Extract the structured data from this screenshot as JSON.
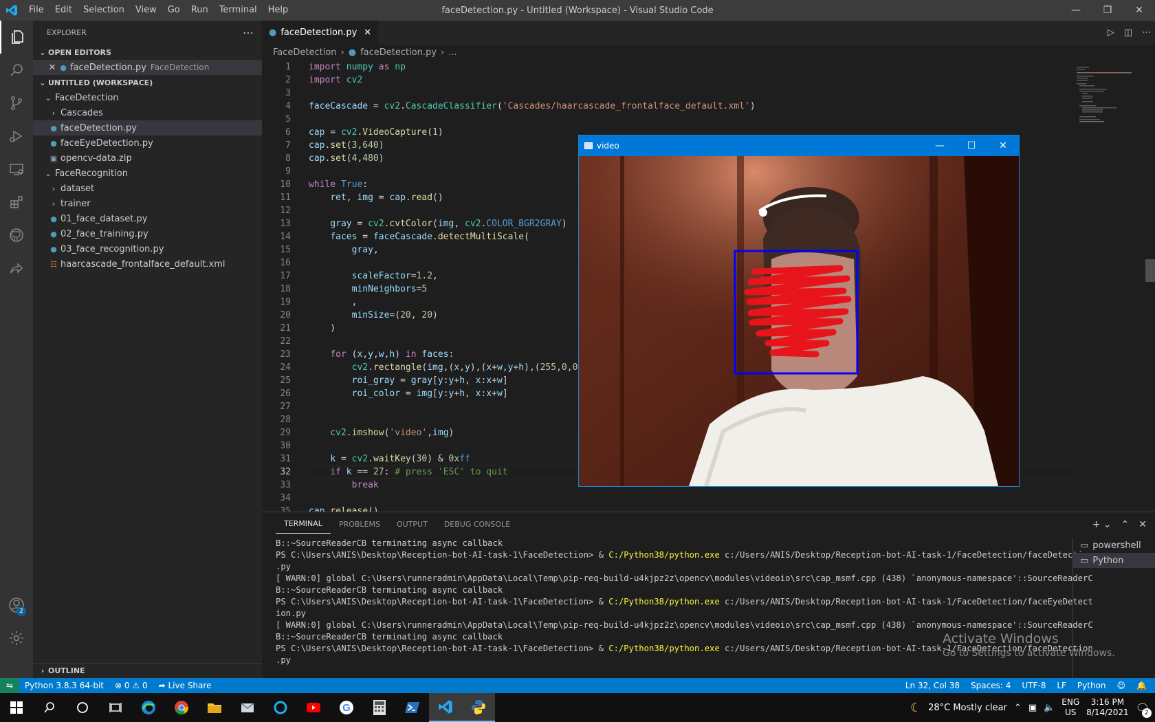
{
  "menu": [
    "File",
    "Edit",
    "Selection",
    "View",
    "Go",
    "Run",
    "Terminal",
    "Help"
  ],
  "window_title": "faceDetection.py - Untitled (Workspace) - Visual Studio Code",
  "sidebar": {
    "header": "EXPLORER",
    "open_editors_label": "OPEN EDITORS",
    "open_editor": {
      "name": "faceDetection.py",
      "folder": "FaceDetection"
    },
    "workspace_label": "UNTITLED (WORKSPACE)",
    "tree": [
      {
        "label": "FaceDetection",
        "kind": "folder-open",
        "depth": 0
      },
      {
        "label": "Cascades",
        "kind": "folder",
        "depth": 1
      },
      {
        "label": "faceDetection.py",
        "kind": "py",
        "depth": 1,
        "selected": true
      },
      {
        "label": "faceEyeDetection.py",
        "kind": "py",
        "depth": 1
      },
      {
        "label": "opencv-data.zip",
        "kind": "zip",
        "depth": 1
      },
      {
        "label": "FaceRecognition",
        "kind": "folder-open",
        "depth": 0
      },
      {
        "label": "dataset",
        "kind": "folder",
        "depth": 1
      },
      {
        "label": "trainer",
        "kind": "folder",
        "depth": 1
      },
      {
        "label": "01_face_dataset.py",
        "kind": "py",
        "depth": 1
      },
      {
        "label": "02_face_training.py",
        "kind": "py",
        "depth": 1
      },
      {
        "label": "03_face_recognition.py",
        "kind": "py",
        "depth": 1
      },
      {
        "label": "haarcascade_frontalface_default.xml",
        "kind": "xml",
        "depth": 1
      }
    ],
    "outline_label": "OUTLINE"
  },
  "editor": {
    "tab_label": "faceDetection.py",
    "breadcrumb": [
      "FaceDetection",
      "faceDetection.py",
      "..."
    ],
    "current_line": 32,
    "lines": [
      [
        [
          "kw",
          "import"
        ],
        [
          "t",
          " "
        ],
        [
          "mod",
          "numpy"
        ],
        [
          "t",
          " "
        ],
        [
          "kw",
          "as"
        ],
        [
          "t",
          " "
        ],
        [
          "mod",
          "np"
        ]
      ],
      [
        [
          "kw",
          "import"
        ],
        [
          "t",
          " "
        ],
        [
          "mod",
          "cv2"
        ]
      ],
      [],
      [
        [
          "var",
          "faceCascade"
        ],
        [
          "t",
          " = "
        ],
        [
          "mod",
          "cv2"
        ],
        [
          "t",
          "."
        ],
        [
          "mod",
          "CascadeClassifier"
        ],
        [
          "t",
          "("
        ],
        [
          "str",
          "'Cascades/haarcascade_frontalface_default.xml'"
        ],
        [
          "t",
          ")"
        ]
      ],
      [],
      [
        [
          "var",
          "cap"
        ],
        [
          "t",
          " = "
        ],
        [
          "mod",
          "cv2"
        ],
        [
          "t",
          "."
        ],
        [
          "fn",
          "VideoCapture"
        ],
        [
          "t",
          "("
        ],
        [
          "num",
          "1"
        ],
        [
          "t",
          ")"
        ]
      ],
      [
        [
          "var",
          "cap"
        ],
        [
          "t",
          "."
        ],
        [
          "fn",
          "set"
        ],
        [
          "t",
          "("
        ],
        [
          "num",
          "3"
        ],
        [
          "t",
          ","
        ],
        [
          "num",
          "640"
        ],
        [
          "t",
          ")"
        ]
      ],
      [
        [
          "var",
          "cap"
        ],
        [
          "t",
          "."
        ],
        [
          "fn",
          "set"
        ],
        [
          "t",
          "("
        ],
        [
          "num",
          "4"
        ],
        [
          "t",
          ","
        ],
        [
          "num",
          "480"
        ],
        [
          "t",
          ")"
        ]
      ],
      [],
      [
        [
          "kw",
          "while"
        ],
        [
          "t",
          " "
        ],
        [
          "kb",
          "True"
        ],
        [
          "t",
          ":"
        ]
      ],
      [
        [
          "t",
          "    "
        ],
        [
          "var",
          "ret"
        ],
        [
          "t",
          ", "
        ],
        [
          "var",
          "img"
        ],
        [
          "t",
          " = "
        ],
        [
          "var",
          "cap"
        ],
        [
          "t",
          "."
        ],
        [
          "fn",
          "read"
        ],
        [
          "t",
          "()"
        ]
      ],
      [],
      [
        [
          "t",
          "    "
        ],
        [
          "var",
          "gray"
        ],
        [
          "t",
          " = "
        ],
        [
          "mod",
          "cv2"
        ],
        [
          "t",
          "."
        ],
        [
          "fn",
          "cvtColor"
        ],
        [
          "t",
          "("
        ],
        [
          "var",
          "img"
        ],
        [
          "t",
          ","
        ],
        [
          "t",
          " "
        ],
        [
          "mod",
          "cv2"
        ],
        [
          "t",
          "."
        ],
        [
          "kb",
          "COLOR_BGR2GRAY"
        ],
        [
          "t",
          ")"
        ]
      ],
      [
        [
          "t",
          "    "
        ],
        [
          "var",
          "faces"
        ],
        [
          "t",
          " = "
        ],
        [
          "var",
          "faceCascade"
        ],
        [
          "t",
          "."
        ],
        [
          "fn",
          "detectMultiScale"
        ],
        [
          "t",
          "("
        ]
      ],
      [
        [
          "t",
          "        "
        ],
        [
          "var",
          "gray"
        ],
        [
          "t",
          ","
        ]
      ],
      [],
      [
        [
          "t",
          "        "
        ],
        [
          "var",
          "scaleFactor"
        ],
        [
          "t",
          "="
        ],
        [
          "num",
          "1.2"
        ],
        [
          "t",
          ","
        ]
      ],
      [
        [
          "t",
          "        "
        ],
        [
          "var",
          "minNeighbors"
        ],
        [
          "t",
          "="
        ],
        [
          "num",
          "5"
        ]
      ],
      [
        [
          "t",
          "        ,"
        ]
      ],
      [
        [
          "t",
          "        "
        ],
        [
          "var",
          "minSize"
        ],
        [
          "t",
          "=("
        ],
        [
          "num",
          "20"
        ],
        [
          "t",
          ", "
        ],
        [
          "num",
          "20"
        ],
        [
          "t",
          ")"
        ]
      ],
      [
        [
          "t",
          "    )"
        ]
      ],
      [],
      [
        [
          "t",
          "    "
        ],
        [
          "kw",
          "for"
        ],
        [
          "t",
          " ("
        ],
        [
          "var",
          "x"
        ],
        [
          "t",
          ","
        ],
        [
          "var",
          "y"
        ],
        [
          "t",
          ","
        ],
        [
          "var",
          "w"
        ],
        [
          "t",
          ","
        ],
        [
          "var",
          "h"
        ],
        [
          "t",
          ") "
        ],
        [
          "kw",
          "in"
        ],
        [
          "t",
          " "
        ],
        [
          "var",
          "faces"
        ],
        [
          "t",
          ":"
        ]
      ],
      [
        [
          "t",
          "        "
        ],
        [
          "mod",
          "cv2"
        ],
        [
          "t",
          "."
        ],
        [
          "fn",
          "rectangle"
        ],
        [
          "t",
          "("
        ],
        [
          "var",
          "img"
        ],
        [
          "t",
          ",("
        ],
        [
          "var",
          "x"
        ],
        [
          "t",
          ","
        ],
        [
          "var",
          "y"
        ],
        [
          "t",
          "),("
        ],
        [
          "var",
          "x"
        ],
        [
          "t",
          "+"
        ],
        [
          "var",
          "w"
        ],
        [
          "t",
          ","
        ],
        [
          "var",
          "y"
        ],
        [
          "t",
          "+"
        ],
        [
          "var",
          "h"
        ],
        [
          "t",
          "),("
        ],
        [
          "num",
          "255"
        ],
        [
          "t",
          ","
        ],
        [
          "num",
          "0"
        ],
        [
          "t",
          ","
        ],
        [
          "num",
          "0"
        ],
        [
          "t",
          ")"
        ]
      ],
      [
        [
          "t",
          "        "
        ],
        [
          "var",
          "roi_gray"
        ],
        [
          "t",
          " = "
        ],
        [
          "var",
          "gray"
        ],
        [
          "t",
          "["
        ],
        [
          "var",
          "y"
        ],
        [
          "t",
          ":"
        ],
        [
          "var",
          "y"
        ],
        [
          "t",
          "+"
        ],
        [
          "var",
          "h"
        ],
        [
          "t",
          ", "
        ],
        [
          "var",
          "x"
        ],
        [
          "t",
          ":"
        ],
        [
          "var",
          "x"
        ],
        [
          "t",
          "+"
        ],
        [
          "var",
          "w"
        ],
        [
          "t",
          "]"
        ]
      ],
      [
        [
          "t",
          "        "
        ],
        [
          "var",
          "roi_color"
        ],
        [
          "t",
          " = "
        ],
        [
          "var",
          "img"
        ],
        [
          "t",
          "["
        ],
        [
          "var",
          "y"
        ],
        [
          "t",
          ":"
        ],
        [
          "var",
          "y"
        ],
        [
          "t",
          "+"
        ],
        [
          "var",
          "h"
        ],
        [
          "t",
          ", "
        ],
        [
          "var",
          "x"
        ],
        [
          "t",
          ":"
        ],
        [
          "var",
          "x"
        ],
        [
          "t",
          "+"
        ],
        [
          "var",
          "w"
        ],
        [
          "t",
          "]"
        ]
      ],
      [],
      [],
      [
        [
          "t",
          "    "
        ],
        [
          "mod",
          "cv2"
        ],
        [
          "t",
          "."
        ],
        [
          "fn",
          "imshow"
        ],
        [
          "t",
          "("
        ],
        [
          "str",
          "'video'"
        ],
        [
          "t",
          ","
        ],
        [
          "var",
          "img"
        ],
        [
          "t",
          ")"
        ]
      ],
      [],
      [
        [
          "t",
          "    "
        ],
        [
          "var",
          "k"
        ],
        [
          "t",
          " = "
        ],
        [
          "mod",
          "cv2"
        ],
        [
          "t",
          "."
        ],
        [
          "fn",
          "waitKey"
        ],
        [
          "t",
          "("
        ],
        [
          "num",
          "30"
        ],
        [
          "t",
          ") & "
        ],
        [
          "num",
          "0x"
        ],
        [
          "kb",
          "ff"
        ]
      ],
      [
        [
          "t",
          "    "
        ],
        [
          "kw",
          "if"
        ],
        [
          "t",
          " "
        ],
        [
          "var",
          "k"
        ],
        [
          "t",
          " == "
        ],
        [
          "num",
          "27"
        ],
        [
          "t",
          ": "
        ],
        [
          "cm",
          "# press 'ESC' to quit"
        ]
      ],
      [
        [
          "t",
          "        "
        ],
        [
          "kw",
          "break"
        ]
      ],
      [],
      [
        [
          "var",
          "cap"
        ],
        [
          "t",
          "."
        ],
        [
          "fn",
          "release"
        ],
        [
          "t",
          "()"
        ]
      ]
    ]
  },
  "video_window": {
    "title": "video",
    "face_box_color": "#0000ff",
    "redaction_color": "#e8141c"
  },
  "panel": {
    "tabs": [
      "TERMINAL",
      "PROBLEMS",
      "OUTPUT",
      "DEBUG CONSOLE"
    ],
    "active_tab": "TERMINAL",
    "terminal_lines": [
      [
        [
          "t",
          "B::~SourceReaderCB terminating async callback"
        ]
      ],
      [
        [
          "t",
          "PS C:\\Users\\ANIS\\Desktop\\Reception-bot-AI-task-1\\FaceDetection> & "
        ],
        [
          "exe",
          "C:/Python38/python.exe"
        ],
        [
          "t",
          " c:/Users/ANIS/Desktop/Reception-bot-AI-task-1/FaceDetection/faceDetection"
        ]
      ],
      [
        [
          "t",
          ".py"
        ]
      ],
      [
        [
          "t",
          "[ WARN:0] global C:\\Users\\runneradmin\\AppData\\Local\\Temp\\pip-req-build-u4kjpz2z\\opencv\\modules\\videoio\\src\\cap_msmf.cpp (438) `anonymous-namespace'::SourceReaderC"
        ]
      ],
      [
        [
          "t",
          "B::~SourceReaderCB terminating async callback"
        ]
      ],
      [
        [
          "t",
          "PS C:\\Users\\ANIS\\Desktop\\Reception-bot-AI-task-1\\FaceDetection> & "
        ],
        [
          "exe",
          "C:/Python38/python.exe"
        ],
        [
          "t",
          " c:/Users/ANIS/Desktop/Reception-bot-AI-task-1/FaceDetection/faceEyeDetect"
        ]
      ],
      [
        [
          "t",
          "ion.py"
        ]
      ],
      [
        [
          "t",
          "[ WARN:0] global C:\\Users\\runneradmin\\AppData\\Local\\Temp\\pip-req-build-u4kjpz2z\\opencv\\modules\\videoio\\src\\cap_msmf.cpp (438) `anonymous-namespace'::SourceReaderC"
        ]
      ],
      [
        [
          "t",
          "B::~SourceReaderCB terminating async callback"
        ]
      ],
      [
        [
          "t",
          "PS C:\\Users\\ANIS\\Desktop\\Reception-bot-AI-task-1\\FaceDetection> & "
        ],
        [
          "exe",
          "C:/Python38/python.exe"
        ],
        [
          "t",
          " c:/Users/ANIS/Desktop/Reception-bot-AI-task-1/FaceDetection/faceDetection"
        ]
      ],
      [
        [
          "t",
          ".py"
        ]
      ]
    ],
    "terminals": [
      "powershell",
      "Python"
    ],
    "selected_terminal": "Python"
  },
  "watermark": {
    "line1": "Activate Windows",
    "line2": "Go to Settings to activate Windows."
  },
  "statusbar": {
    "python": "Python 3.8.3 64-bit",
    "errors": "0",
    "warnings": "0",
    "live_share": "Live Share",
    "position": "Ln 32, Col 38",
    "spaces": "Spaces: 4",
    "encoding": "UTF-8",
    "eol": "LF",
    "language": "Python"
  },
  "activity_badge": "2",
  "taskbar": {
    "weather": "28°C  Mostly clear",
    "lang1": "ENG",
    "lang2": "US",
    "time": "3:16 PM",
    "date": "8/14/2021",
    "notif_count": "2"
  }
}
